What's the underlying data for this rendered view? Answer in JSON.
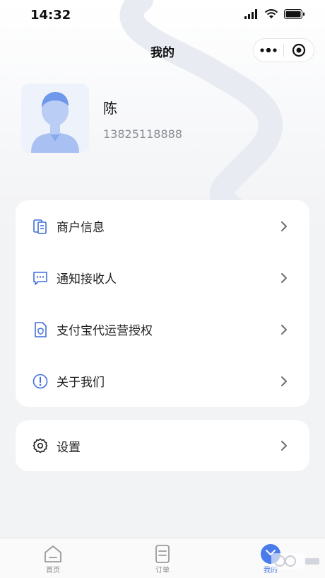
{
  "status": {
    "time": "14:32"
  },
  "nav": {
    "title": "我的"
  },
  "profile": {
    "name": "陈",
    "phone": "13825118888"
  },
  "menu": {
    "items": [
      {
        "label": "商户信息",
        "icon": "merchant-info-icon"
      },
      {
        "label": "通知接收人",
        "icon": "message-icon"
      },
      {
        "label": "支付宝代运营授权",
        "icon": "shield-document-icon"
      },
      {
        "label": "关于我们",
        "icon": "info-icon"
      }
    ],
    "settings": {
      "label": "设置",
      "icon": "gear-icon"
    }
  },
  "tabbar": {
    "tabs": [
      {
        "label": "首页",
        "icon": "home-icon"
      },
      {
        "label": "订单",
        "icon": "order-icon"
      },
      {
        "label": "我的",
        "icon": "profile-icon",
        "active": true
      }
    ]
  },
  "colors": {
    "accent": "#4a7bea",
    "icon_blue": "#3f6fd8",
    "background": "#f2f3f5"
  }
}
